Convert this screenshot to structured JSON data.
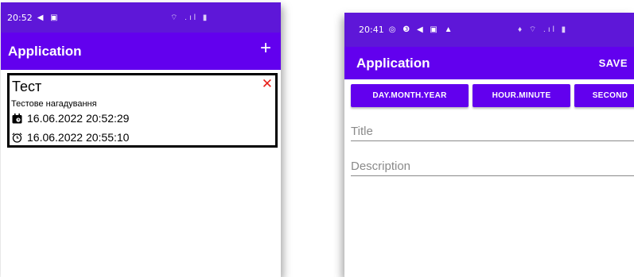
{
  "left_screen": {
    "status_bar": {
      "time": "20:52",
      "glyphs": "◀ ▣",
      "right": "⌔ .ıl ▮"
    },
    "app_bar": {
      "title": "Application",
      "add_symbol": "+"
    },
    "card": {
      "title": "Тест",
      "close_symbol": "✕",
      "description": "Тестове нагадування",
      "created": "16.06.2022 20:52:29",
      "reminder": "16.06.2022 20:55:10"
    }
  },
  "right_screen": {
    "status_bar": {
      "time": "20:41",
      "glyphs": "◎ ❸ ◀ ▣ ▲",
      "right": "♦ ⌔ .ıl ▮"
    },
    "app_bar": {
      "title": "Application",
      "save_label": "SAVE"
    },
    "buttons": {
      "date": "DAY.MONTH.YEAR",
      "time": "HOUR.MINUTE",
      "second": "SECOND"
    },
    "fields": {
      "title_placeholder": "Title",
      "description_placeholder": "Description"
    }
  },
  "colors": {
    "app_bar": "#6200ee",
    "status_bar": "#5e17d8",
    "close": "#e8201a"
  },
  "icons": [
    "add-icon",
    "close-icon",
    "calendar-icon",
    "alarm-clock-icon"
  ]
}
